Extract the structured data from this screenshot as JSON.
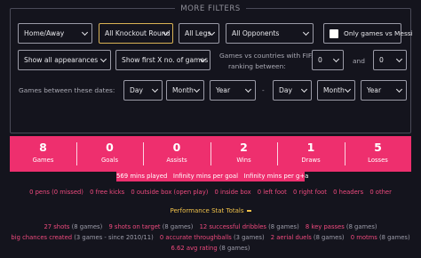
{
  "filters": {
    "title": "MORE FILTERS",
    "home_away": "Home/Away",
    "round": "All Knockout Round",
    "legs": "All Legs",
    "opponents": "All Opponents",
    "messi_only_label": "Only games vs Messi",
    "appearances": "Show all appearances",
    "first_x": "Show first X no. of games",
    "fifa_label_1": "Games vs countries with FIFA",
    "fifa_label_2": "ranking between:",
    "fifa_from": "0",
    "and_label": "and",
    "fifa_to": "0",
    "dates_label": "Games between these dates:",
    "from_day": "Day",
    "from_month": "Month",
    "from_year": "Year",
    "dash": "-",
    "to_day": "Day",
    "to_month": "Month",
    "to_year": "Year"
  },
  "stats": [
    {
      "value": "8",
      "label": "Games"
    },
    {
      "value": "0",
      "label": "Goals"
    },
    {
      "value": "0",
      "label": "Assists"
    },
    {
      "value": "2",
      "label": "Wins"
    },
    {
      "value": "1",
      "label": "Draws"
    },
    {
      "value": "5",
      "label": "Losses"
    }
  ],
  "minutes": {
    "played": "569 mins played",
    "per_goal": "Infinity mins per goal",
    "per_ga": "Infinity mins per g+a"
  },
  "goal_types": [
    {
      "value": "0 pens (0 missed)"
    },
    {
      "value": "0 free kicks"
    },
    {
      "value": "0 outside box (open play)"
    },
    {
      "value": "0 inside box"
    },
    {
      "value": "0 left foot"
    },
    {
      "value": "0 right foot"
    },
    {
      "value": "0 headers"
    },
    {
      "value": "0 other"
    }
  ],
  "performance": {
    "title": "Performance Stat Totals",
    "row1": [
      {
        "value": "27 shots",
        "games": "(8 games)"
      },
      {
        "value": "9 shots on target",
        "games": "(8 games)"
      },
      {
        "value": "12 successful dribbles",
        "games": "(8 games)"
      },
      {
        "value": "8 key passes",
        "games": "(8 games)"
      }
    ],
    "row2": [
      {
        "value": "big chances created",
        "games": "(3 games - since 2010/11)"
      },
      {
        "value": "0 accurate throughballs",
        "games": "(3 games)"
      },
      {
        "value": "2 aerial duels",
        "games": "(8 games)"
      },
      {
        "value": "0 motms",
        "games": "(8 games)"
      }
    ],
    "row3": [
      {
        "value": "6.62 avg rating",
        "games": "(8 games)"
      }
    ]
  },
  "colors": {
    "accent": "#ee2f6e",
    "gold": "#d8b255",
    "background": "#14141d"
  }
}
